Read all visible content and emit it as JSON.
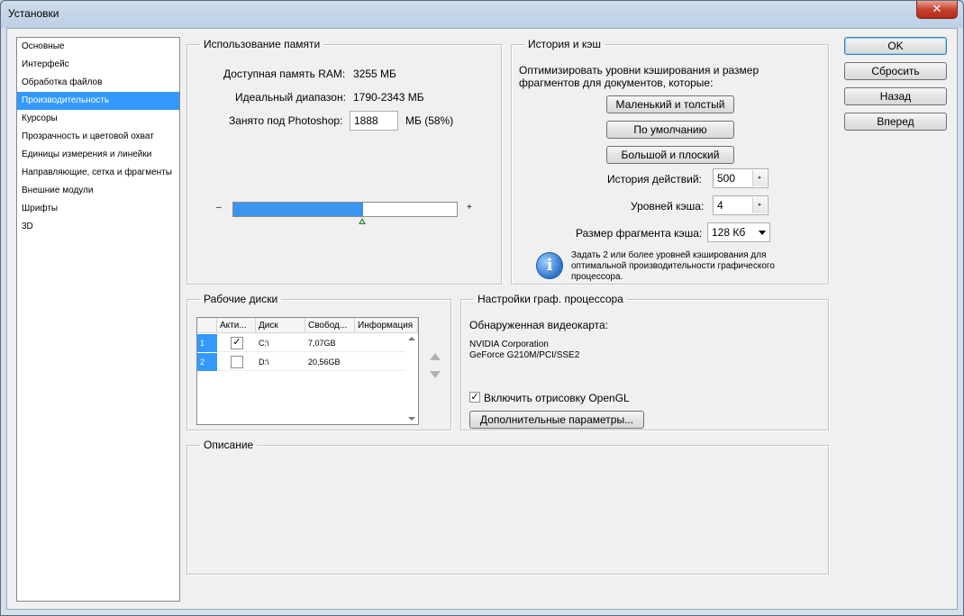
{
  "window": {
    "title": "Установки",
    "close_glyph": "✕"
  },
  "nav": {
    "items": [
      "Основные",
      "Интерфейс",
      "Обработка файлов",
      "Производительность",
      "Курсоры",
      "Прозрачность и цветовой охват",
      "Единицы измерения и линейки",
      "Направляющие, сетка и фрагменты",
      "Внешние модули",
      "Шрифты",
      "3D"
    ],
    "selected_index": 3
  },
  "memory": {
    "legend": "Использование памяти",
    "available_label": "Доступная память RAM:",
    "available_value": "3255 МБ",
    "ideal_label": "Идеальный диапазон:",
    "ideal_value": "1790-2343 МБ",
    "used_label": "Занято под Photoshop:",
    "used_value": "1888",
    "used_suffix": "МБ (58%)",
    "minus": "–",
    "plus": "+",
    "slider_fraction": 0.58
  },
  "history": {
    "legend": "История и кэш",
    "description": "Оптимизировать уровни кэширования и размер фрагментов для документов, которые:",
    "buttons": [
      "Маленький и толстый",
      "По умолчанию",
      "Большой и плоский"
    ],
    "history_states_label": "История действий:",
    "history_states_value": "500",
    "cache_levels_label": "Уровней кэша:",
    "cache_levels_value": "4",
    "tile_size_label": "Размер фрагмента кэша:",
    "tile_size_value": "128 Кб",
    "info_text": "Задать 2 или более уровней кэширования для оптимальной производительности графического процессора."
  },
  "scratch": {
    "legend": "Рабочие диски",
    "columns": [
      "Акти...",
      "Диск",
      "Свобод...",
      "Информация"
    ],
    "rows": [
      {
        "num": "1",
        "active": true,
        "disk": "C:\\",
        "free": "7,07GB",
        "info": ""
      },
      {
        "num": "2",
        "active": false,
        "disk": "D:\\",
        "free": "20,56GB",
        "info": ""
      }
    ]
  },
  "gpu": {
    "legend": "Настройки граф. процессора",
    "detected_label": "Обнаруженная видеокарта:",
    "vendor": "NVIDIA Corporation",
    "model": "GeForce G210M/PCI/SSE2",
    "opengl_label": "Включить отрисовку OpenGL",
    "opengl_checked": true,
    "advanced_button": "Дополнительные параметры..."
  },
  "description": {
    "legend": "Описание",
    "text": ""
  },
  "actions": {
    "ok": "OK",
    "reset": "Сбросить",
    "prev": "Назад",
    "next": "Вперед"
  },
  "colors": {
    "selection": "#3399ff",
    "bar_fill": "#3a95ee"
  }
}
